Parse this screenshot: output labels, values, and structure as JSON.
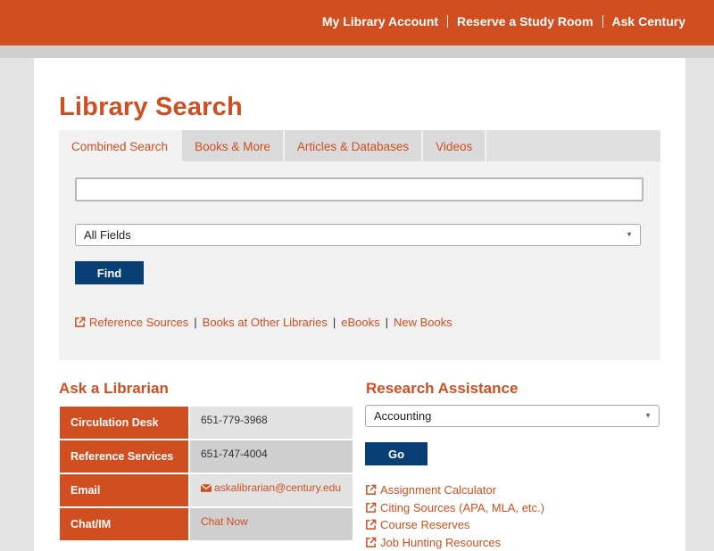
{
  "header": {
    "nav": [
      "My Library Account",
      "Reserve a Study Room",
      "Ask Century"
    ]
  },
  "page_title": "Library Search",
  "search": {
    "tabs": [
      "Combined Search",
      "Books & More",
      "Articles & Databases",
      "Videos"
    ],
    "active_tab": "Combined Search",
    "query_value": "",
    "field_select": "All Fields",
    "find_label": "Find",
    "links": [
      "Reference Sources",
      "Books at Other Libraries",
      "eBooks",
      "New Books"
    ]
  },
  "ask": {
    "title": "Ask a Librarian",
    "rows": [
      {
        "label": "Circulation Desk",
        "value": "651-779-3968"
      },
      {
        "label": "Reference Services",
        "value": "651-747-4004"
      },
      {
        "label": "Email",
        "value": "askalibrarian@century.edu"
      },
      {
        "label": "Chat/IM",
        "value": "Chat Now"
      }
    ]
  },
  "research": {
    "title": "Research Assistance",
    "subject_select": "Accounting",
    "go_label": "Go",
    "links": [
      "Assignment Calculator",
      "Citing Sources (APA, MLA, etc.)",
      "Course Reserves",
      "Job Hunting Resources"
    ]
  },
  "colors": {
    "brand": "#d04e1f",
    "button": "#083f75"
  }
}
